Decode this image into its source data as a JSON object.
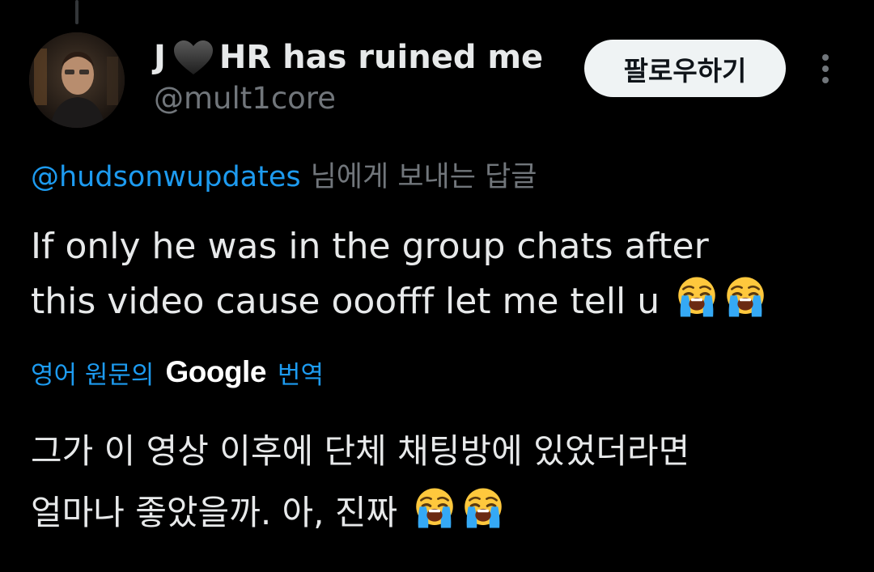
{
  "tweet": {
    "author": {
      "name_prefix": "J",
      "name_heart": "black-heart-icon",
      "name_suffix": "HR has ruined me",
      "handle": "@mult1core"
    },
    "follow_button_label": "팔로우하기",
    "more_menu_icon": "vertical-ellipsis-icon",
    "reply_to": {
      "mention": "@hudsonwupdates",
      "suffix": "님에게 보내는 답글"
    },
    "text": {
      "line1": "If only he was in the group chats after",
      "line2": "this video cause ooofff let me tell u",
      "emojis": [
        "loudly-crying-face",
        "loudly-crying-face"
      ]
    },
    "translation": {
      "prefix": "영어 원문의",
      "brand": "Google",
      "suffix": "번역",
      "line1": "그가 이 영상 이후에 단체 채팅방에 있었더라면",
      "line2": "얼마나 좋았을까. 아, 진짜",
      "emojis": [
        "loudly-crying-face",
        "loudly-crying-face"
      ]
    }
  },
  "colors": {
    "background": "#000000",
    "primary_text": "#e7e9ea",
    "secondary_text": "#71767b",
    "link_blue": "#1d9bf0",
    "follow_button_bg": "#eff3f4"
  }
}
